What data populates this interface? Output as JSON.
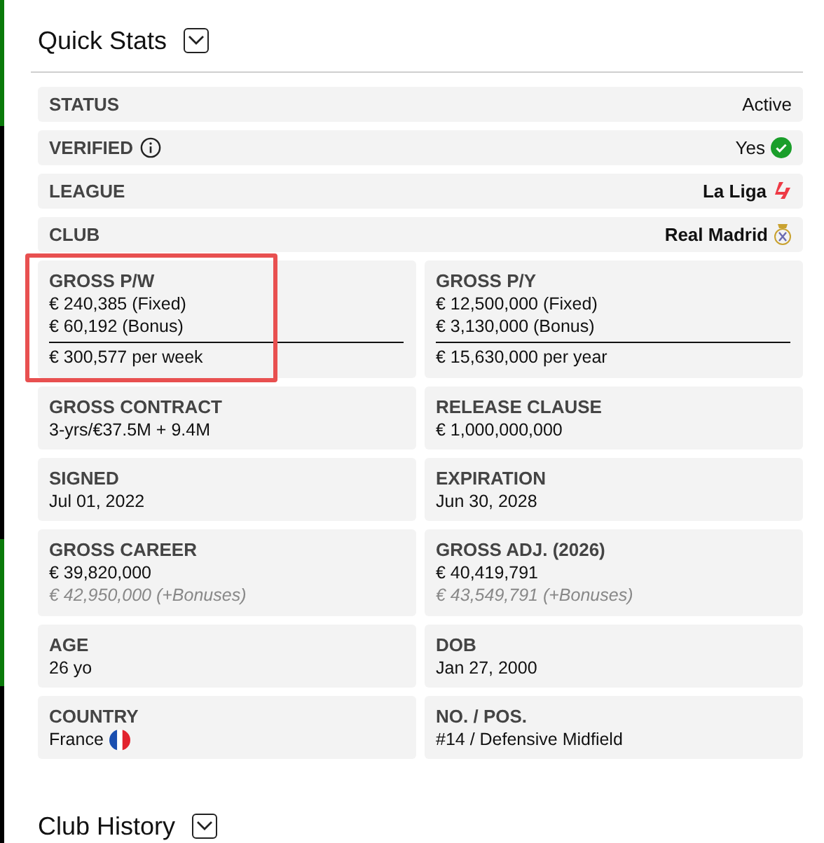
{
  "section": {
    "title": "Quick Stats",
    "expanded": true
  },
  "rows": [
    {
      "label": "STATUS",
      "value": "Active"
    },
    {
      "label": "VERIFIED",
      "info": true,
      "value": "Yes",
      "kind": "verified"
    },
    {
      "label": "LEAGUE",
      "value": "La Liga",
      "bold": true,
      "kind": "league"
    },
    {
      "label": "CLUB",
      "value": "Real Madrid",
      "bold": true,
      "kind": "club"
    }
  ],
  "cells": [
    {
      "label": "GROSS P/W",
      "values": [
        "€ 240,385 (Fixed)",
        "€ 60,192 (Bonus)"
      ],
      "total": "€ 300,577 per week",
      "highlighted": true
    },
    {
      "label": "GROSS P/Y",
      "values": [
        "€ 12,500,000 (Fixed)",
        "€ 3,130,000 (Bonus)"
      ],
      "total": "€ 15,630,000 per year",
      "highlighted": false
    },
    {
      "label": "GROSS CONTRACT",
      "values": [
        "3-yrs/€37.5M + 9.4M"
      ],
      "highlighted": false
    },
    {
      "label": "RELEASE CLAUSE",
      "values": [
        "€ 1,000,000,000"
      ],
      "highlighted": false
    },
    {
      "label": "SIGNED",
      "values": [
        "Jul 01, 2022"
      ],
      "highlighted": false
    },
    {
      "label": "EXPIRATION",
      "values": [
        "Jun 30, 2028"
      ],
      "highlighted": false
    },
    {
      "label": "GROSS CAREER",
      "values": [
        "€ 39,820,000"
      ],
      "note": "€ 42,950,000 (+Bonuses)",
      "highlighted": false
    },
    {
      "label": "GROSS ADJ. (2026)",
      "values": [
        "€ 40,419,791"
      ],
      "note": "€ 43,549,791 (+Bonuses)",
      "highlighted": false
    },
    {
      "label": "AGE",
      "values": [
        "26 yo"
      ],
      "highlighted": false
    },
    {
      "label": "DOB",
      "values": [
        "Jan 27, 2000"
      ],
      "highlighted": false
    },
    {
      "label": "COUNTRY",
      "values": [
        "France"
      ],
      "kind": "country",
      "highlighted": false
    },
    {
      "label": "NO. / POS.",
      "values": [
        "#14 / Defensive Midfield"
      ],
      "highlighted": false
    }
  ],
  "next_section": {
    "title": "Club History",
    "expanded": true
  }
}
